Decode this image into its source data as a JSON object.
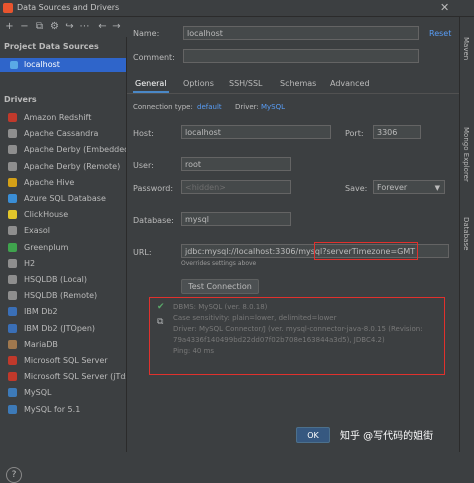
{
  "window": {
    "title": "Data Sources and Drivers"
  },
  "left": {
    "project_header": "Project Data Sources",
    "selected_source": "localhost",
    "drivers_header": "Drivers",
    "drivers": [
      {
        "label": "Amazon Redshift",
        "color": "#c0392b"
      },
      {
        "label": "Apache Cassandra",
        "color": "#8e8e8e"
      },
      {
        "label": "Apache Derby (Embedded)",
        "color": "#8e8e8e"
      },
      {
        "label": "Apache Derby (Remote)",
        "color": "#8e8e8e"
      },
      {
        "label": "Apache Hive",
        "color": "#d4a017"
      },
      {
        "label": "Azure SQL Database",
        "color": "#3a8ed6"
      },
      {
        "label": "ClickHouse",
        "color": "#e2c62b"
      },
      {
        "label": "Exasol",
        "color": "#8e8e8e"
      },
      {
        "label": "Greenplum",
        "color": "#3fa34d"
      },
      {
        "label": "H2",
        "color": "#8e8e8e"
      },
      {
        "label": "HSQLDB (Local)",
        "color": "#8e8e8e"
      },
      {
        "label": "HSQLDB (Remote)",
        "color": "#8e8e8e"
      },
      {
        "label": "IBM Db2",
        "color": "#3a6fb7"
      },
      {
        "label": "IBM Db2 (JTOpen)",
        "color": "#3a6fb7"
      },
      {
        "label": "MariaDB",
        "color": "#a0784e"
      },
      {
        "label": "Microsoft SQL Server",
        "color": "#c0392b"
      },
      {
        "label": "Microsoft SQL Server (jTds)",
        "color": "#c0392b"
      },
      {
        "label": "MySQL",
        "color": "#3d7ab8"
      },
      {
        "label": "MySQL for 5.1",
        "color": "#3d7ab8"
      }
    ],
    "help_label": "?"
  },
  "form": {
    "name_label": "Name:",
    "name_value": "localhost",
    "reset_label": "Reset",
    "comment_label": "Comment:",
    "tabs": [
      "General",
      "Options",
      "SSH/SSL",
      "Schemas",
      "Advanced"
    ],
    "connection_type_label": "Connection type:",
    "connection_type_value": "default",
    "driver_label": "Driver:",
    "driver_value": "MySQL",
    "host_label": "Host:",
    "host_value": "localhost",
    "port_label": "Port:",
    "port_value": "3306",
    "user_label": "User:",
    "user_value": "root",
    "password_label": "Password:",
    "password_value": "<hidden>",
    "save_label": "Save:",
    "save_value": "Forever",
    "database_label": "Database:",
    "database_value": "mysql",
    "url_label": "URL:",
    "url_value_prefix": "jdbc:mysql://localhost:3306/mysql",
    "url_value_highlight": "?serverTimezone=GMT",
    "url_hint": "Overrides settings above",
    "test_button": "Test Connection",
    "result_lines": [
      "DBMS: MySQL (ver. 8.0.18)",
      "Case sensitivity: plain=lower, delimited=lower",
      "Driver: MySQL Connector/J (ver. mysql-connector-java-8.0.15 (Revision:",
      "79a4336f140499bd22dd07f02b708e163844a3d5), JDBC4.2)",
      "Ping: 40 ms"
    ]
  },
  "footer": {
    "ok_label": "OK",
    "watermark": "知乎 @写代码的姐街"
  },
  "right_strip": [
    "Database",
    "Mongo Explorer",
    "Maven"
  ]
}
